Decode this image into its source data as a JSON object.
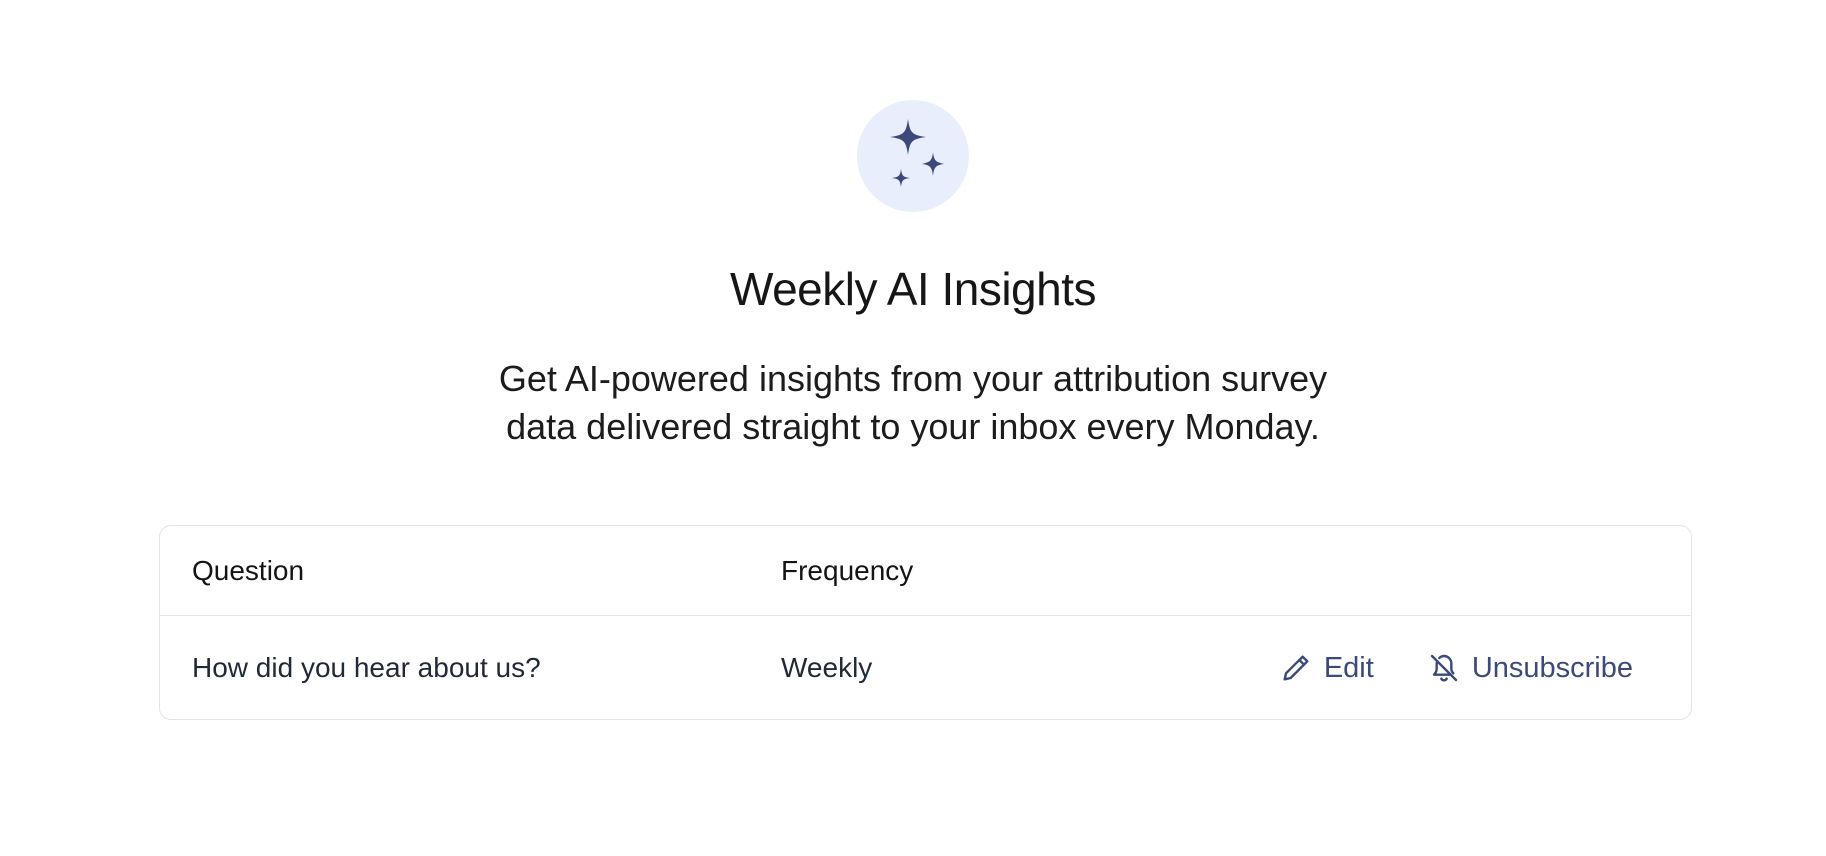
{
  "header": {
    "icon": "sparkles-icon",
    "title": "Weekly AI Insights",
    "subtitle": "Get AI-powered insights from your attribution survey data delivered straight to your inbox every Monday."
  },
  "table": {
    "columns": [
      "Question",
      "Frequency"
    ],
    "rows": [
      {
        "question": "How did you hear about us?",
        "frequency": "Weekly",
        "actions": [
          {
            "label": "Edit",
            "icon": "pencil-icon"
          },
          {
            "label": "Unsubscribe",
            "icon": "bell-off-icon"
          }
        ]
      }
    ]
  },
  "colors": {
    "accent": "#3b4a7a",
    "icon_bg": "#e9eefc",
    "border": "#e2e4e8"
  }
}
